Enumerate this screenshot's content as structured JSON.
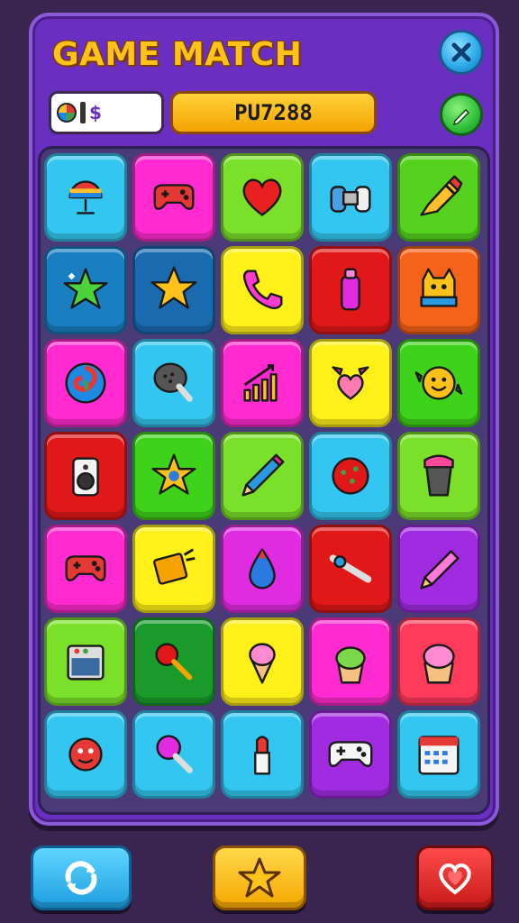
{
  "header": {
    "title": "GAME MATCH",
    "currency_symbol": "$",
    "player_code": "PU7288"
  },
  "icons": {
    "close": "close-icon",
    "edit": "pencil-icon",
    "refresh": "refresh-icon",
    "favorite": "star-icon",
    "lives": "heart-icon"
  },
  "colors": {
    "panel": "#6a2fc0",
    "title": "#ffc21a",
    "code_button": "#f4a300"
  },
  "board": {
    "rows": 7,
    "columns": 5,
    "tiles": [
      {
        "icon": "striped-lamp",
        "color": "#33c6f0"
      },
      {
        "icon": "gamepad",
        "color": "#ff2bd0"
      },
      {
        "icon": "heart",
        "color": "#7be02a"
      },
      {
        "icon": "controller",
        "color": "#33c6f0"
      },
      {
        "icon": "pencil-brush",
        "color": "#54d21e"
      },
      {
        "icon": "green-star",
        "color": "#1a7fc0"
      },
      {
        "icon": "yellow-star",
        "color": "#1a6ab0"
      },
      {
        "icon": "phone",
        "color": "#fff01a"
      },
      {
        "icon": "bottle",
        "color": "#e01818"
      },
      {
        "icon": "cat-scarf",
        "color": "#f5621a"
      },
      {
        "icon": "swirl-orb",
        "color": "#ff2bd0"
      },
      {
        "icon": "microphone",
        "color": "#33c6f0"
      },
      {
        "icon": "bar-graph",
        "color": "#ff2bd0"
      },
      {
        "icon": "winged-heart",
        "color": "#fff01a"
      },
      {
        "icon": "smiley-candy",
        "color": "#3fd21a"
      },
      {
        "icon": "speaker",
        "color": "#e01818"
      },
      {
        "icon": "star-badge",
        "color": "#3fd21a"
      },
      {
        "icon": "marker",
        "color": "#7be02a"
      },
      {
        "icon": "red-ball",
        "color": "#33c6f0"
      },
      {
        "icon": "cup",
        "color": "#7be02a"
      },
      {
        "icon": "gamepad",
        "color": "#ff2bd0"
      },
      {
        "icon": "phone-card",
        "color": "#fff01a"
      },
      {
        "icon": "drop",
        "color": "#e02be0"
      },
      {
        "icon": "pin",
        "color": "#e01818"
      },
      {
        "icon": "pencil",
        "color": "#a02be0"
      },
      {
        "icon": "radio",
        "color": "#7be02a"
      },
      {
        "icon": "lollipop",
        "color": "#1a9a2a"
      },
      {
        "icon": "ice-cream",
        "color": "#fff01a"
      },
      {
        "icon": "green-cupcake",
        "color": "#ff2bd0"
      },
      {
        "icon": "pink-cupcake",
        "color": "#ff3a5a"
      },
      {
        "icon": "red-monster",
        "color": "#33c6f0"
      },
      {
        "icon": "candy-stick",
        "color": "#33c6f0"
      },
      {
        "icon": "lipstick",
        "color": "#33c6f0"
      },
      {
        "icon": "white-gamepad",
        "color": "#a02be0"
      },
      {
        "icon": "calendar",
        "color": "#33c6f0"
      }
    ]
  }
}
